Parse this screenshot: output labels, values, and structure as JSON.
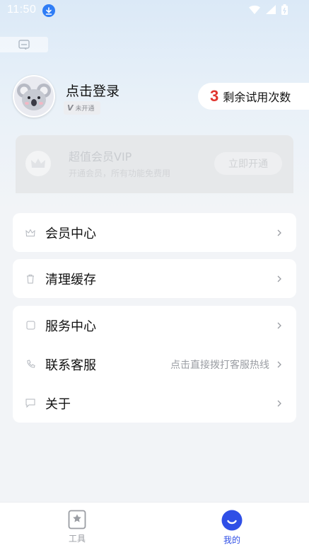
{
  "status_bar": {
    "time": "11:50"
  },
  "profile": {
    "login_text": "点击登录",
    "vip_status": "未开通",
    "vip_mark": "V"
  },
  "trial": {
    "count": "3",
    "label": "剩余试用次数"
  },
  "vip_card": {
    "title": "超值会员VIP",
    "subtitle": "开通会员，所有功能免费用",
    "button": "立即开通"
  },
  "menu": {
    "member_center": "会员中心",
    "clear_cache": "清理缓存",
    "service_center": "服务中心",
    "contact_service": "联系客服",
    "contact_hint": "点击直接拨打客服热线",
    "about": "关于"
  },
  "bottom_nav": {
    "tools": "工具",
    "mine": "我的"
  },
  "colors": {
    "accent": "#2f4fe6",
    "trial_number": "#e0342e",
    "download_badge": "#2f7df6"
  },
  "icons": {
    "download": "download-icon",
    "scan": "scan-icon",
    "avatar": "koala-avatar",
    "member": "crown-icon",
    "cache": "trash-icon",
    "service": "service-icon",
    "contact": "phone-icon",
    "about": "message-icon",
    "tools": "star-bookmark-icon",
    "mine": "smile-icon"
  }
}
